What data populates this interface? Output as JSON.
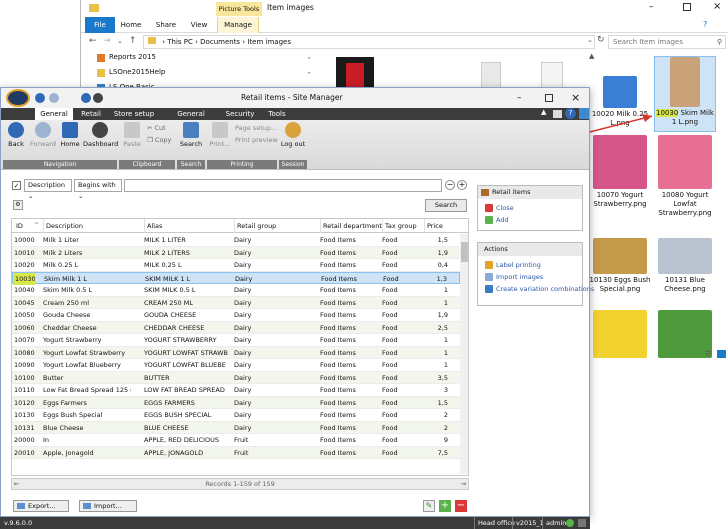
{
  "explorer": {
    "window_title": "Item images",
    "contextual_tab": "Picture Tools",
    "tabs": [
      "File",
      "Home",
      "Share",
      "View",
      "Manage"
    ],
    "path": [
      "This PC",
      "Documents",
      "Item images"
    ],
    "search_placeholder": "Search Item images",
    "nav_items": [
      "Reports 2015",
      "LSOne2015Help",
      "LS One Basic"
    ],
    "thumbnails": [
      {
        "label": "10020 Milk 0.25 L.png",
        "color": "#3b7fd4"
      },
      {
        "label_prefix": "10030",
        "label_rest": " Skim Milk 1 L.png",
        "color": "#c9a27a",
        "selected": true
      },
      {
        "label": "10070 Yogurt Strawberry.png",
        "color": "#d7568a"
      },
      {
        "label": "10080 Yogurt Lowfat Strawberry.png",
        "color": "#e86f94"
      },
      {
        "label": "10130 Eggs Bush Special.png",
        "color": "#c49a4b"
      },
      {
        "label": "10131 Blue Cheese.png",
        "color": "#b8c3cf"
      },
      {
        "label": "",
        "color": "#f2d22e"
      },
      {
        "label": "",
        "color": "#4f9a3c"
      }
    ]
  },
  "retail": {
    "title": "Retail items - Site Manager",
    "tabs": [
      "General",
      "Retail",
      "Store setup",
      "General setup",
      "Security",
      "Tools"
    ],
    "ribbon": {
      "back": "Back",
      "forward": "Forward",
      "home": "Home",
      "dashboard": "Dashboard",
      "paste": "Paste",
      "cut": "Cut",
      "copy": "Copy",
      "search": "Search",
      "print": "Print...",
      "page_setup": "Page setup...",
      "print_preview": "Print preview",
      "logout": "Log out",
      "groups": [
        "Navigation",
        "Clipboard",
        "Search",
        "Printing",
        "Session"
      ]
    },
    "filter": {
      "field": "Description",
      "operator": "Begins with",
      "search_button": "Search"
    },
    "columns": [
      "ID",
      "Description",
      "Alias",
      "Retail group",
      "Retail department",
      "Tax group",
      "Price"
    ],
    "rows": [
      [
        "10000",
        "Milk 1 Liter",
        "MILK 1 LITER",
        "Dairy",
        "Food Items",
        "Food",
        "1,5"
      ],
      [
        "10010",
        "Milk 2 Liters",
        "MILK 2 LITERS",
        "Dairy",
        "Food Items",
        "Food",
        "1,9"
      ],
      [
        "10020",
        "Milk 0.25 L",
        "MILK 0.25 L",
        "Dairy",
        "Food Items",
        "Food",
        "0,4"
      ],
      [
        "10030",
        "Skim Milk 1 L",
        "SKIM MILK 1 L",
        "Dairy",
        "Food Items",
        "Food",
        "1,3"
      ],
      [
        "10040",
        "Skim Milk 0.5 L",
        "SKIM MILK 0.5 L",
        "Dairy",
        "Food Items",
        "Food",
        "1"
      ],
      [
        "10045",
        "Cream 250 ml",
        "CREAM 250 ML",
        "Dairy",
        "Food Items",
        "Food",
        "1"
      ],
      [
        "10050",
        "Gouda Cheese",
        "GOUDA CHEESE",
        "Dairy",
        "Food Items",
        "Food",
        "1,9"
      ],
      [
        "10060",
        "Cheddar Cheese",
        "CHEDDAR CHEESE",
        "Dairy",
        "Food Items",
        "Food",
        "2,5"
      ],
      [
        "10070",
        "Yogurt Strawberry",
        "YOGURT STRAWBERRY",
        "Dairy",
        "Food Items",
        "Food",
        "1"
      ],
      [
        "10080",
        "Yogurt Lowfat Strawberry",
        "YOGURT LOWFAT STRAWB",
        "Dairy",
        "Food Items",
        "Food",
        "1"
      ],
      [
        "10090",
        "Yogurt Lowfat Blueberry",
        "YOGURT LOWFAT BLUEBE",
        "Dairy",
        "Food Items",
        "Food",
        "1"
      ],
      [
        "10100",
        "Butter",
        "BUTTER",
        "Dairy",
        "Food Items",
        "Food",
        "3,5"
      ],
      [
        "10110",
        "Low Fat Bread Spread 125 g",
        "LOW FAT BREAD SPREAD",
        "Dairy",
        "Food Items",
        "Food",
        "3"
      ],
      [
        "10120",
        "Eggs Farmers",
        "EGGS FARMERS",
        "Dairy",
        "Food Items",
        "Food",
        "1,5"
      ],
      [
        "10130",
        "Eggs Bush Special",
        "EGGS BUSH SPECIAL",
        "Dairy",
        "Food Items",
        "Food",
        "2"
      ],
      [
        "10131",
        "Blue Cheese",
        "BLUE CHEESE",
        "Dairy",
        "Food Items",
        "Food",
        "2"
      ],
      [
        "20000",
        "In",
        "APPLE, RED DELICIOUS",
        "Fruit",
        "Food Items",
        "Food",
        "9"
      ],
      [
        "20010",
        "Apple, Jonagold",
        "APPLE, JONAGOLD",
        "Fruit",
        "Food Items",
        "Food",
        "7,5"
      ]
    ],
    "selected_row": 3,
    "records": "Records 1-159 of 159",
    "retail_items_panel": {
      "title": "Retail items",
      "items": [
        "Close",
        "Add"
      ]
    },
    "actions_panel": {
      "title": "Actions",
      "items": [
        "Label printing",
        "Import images",
        "Create variation combinations"
      ]
    },
    "export": "Export...",
    "import": "Import...",
    "status": {
      "version": "v.9.6.0.0",
      "segments": [
        "Head office",
        "v2015_1",
        "admin"
      ]
    }
  },
  "colors": {
    "selection": "#cfe3f7",
    "accent": "#2e58a6",
    "highlight": "#d8e84a"
  }
}
